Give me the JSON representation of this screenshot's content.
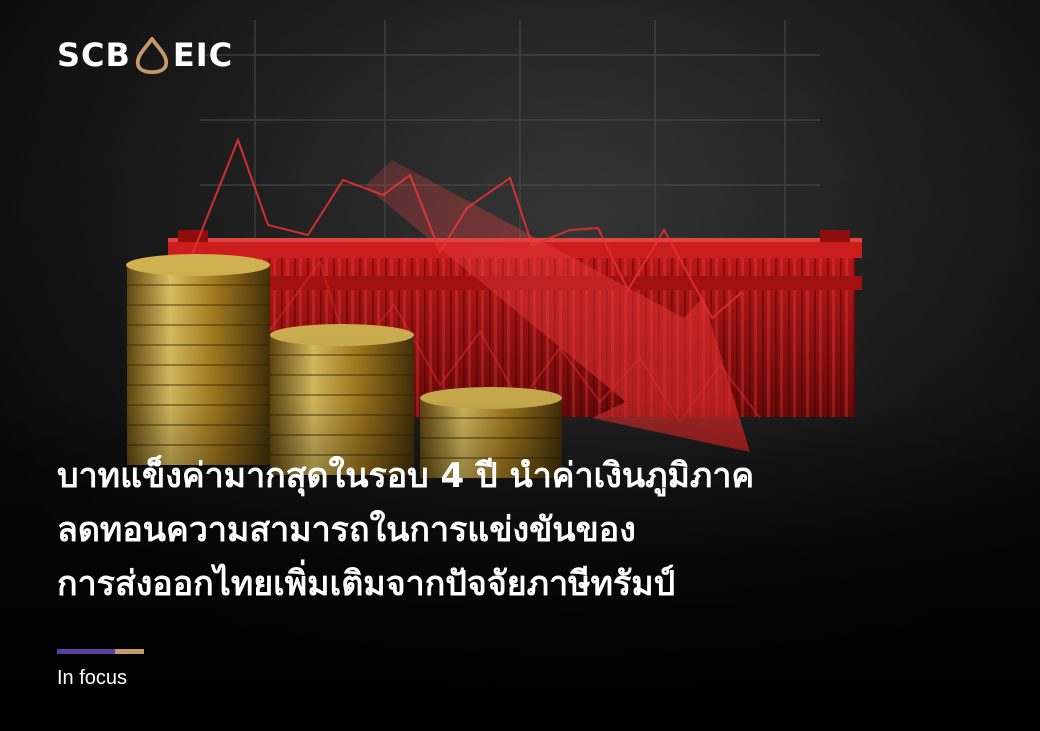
{
  "logo": {
    "left": "SCB",
    "right": "EIC",
    "mark_icon": "scb-eic-bell-icon",
    "mark_color": "#c49a6c"
  },
  "headline": {
    "lines": [
      "บาทแข็งค่ามากสุดในรอบ 4 ปี นำค่าเงินภูมิภาค",
      "ลดทอนความสามารถในการแข่งขันของ",
      "การส่งออกไทยเพิ่มเติมจากปัจจัยภาษีทรัมป์"
    ]
  },
  "tag": "In focus",
  "colors": {
    "accent_purple": "#5b3f9e",
    "accent_gold": "#c49a6c",
    "container_red": "#c41414",
    "coin_gold": "#c9a437"
  },
  "illustration": {
    "icons": [
      "coin-stack-icon",
      "shipping-container-icon",
      "downtrend-arrow-icon"
    ]
  }
}
